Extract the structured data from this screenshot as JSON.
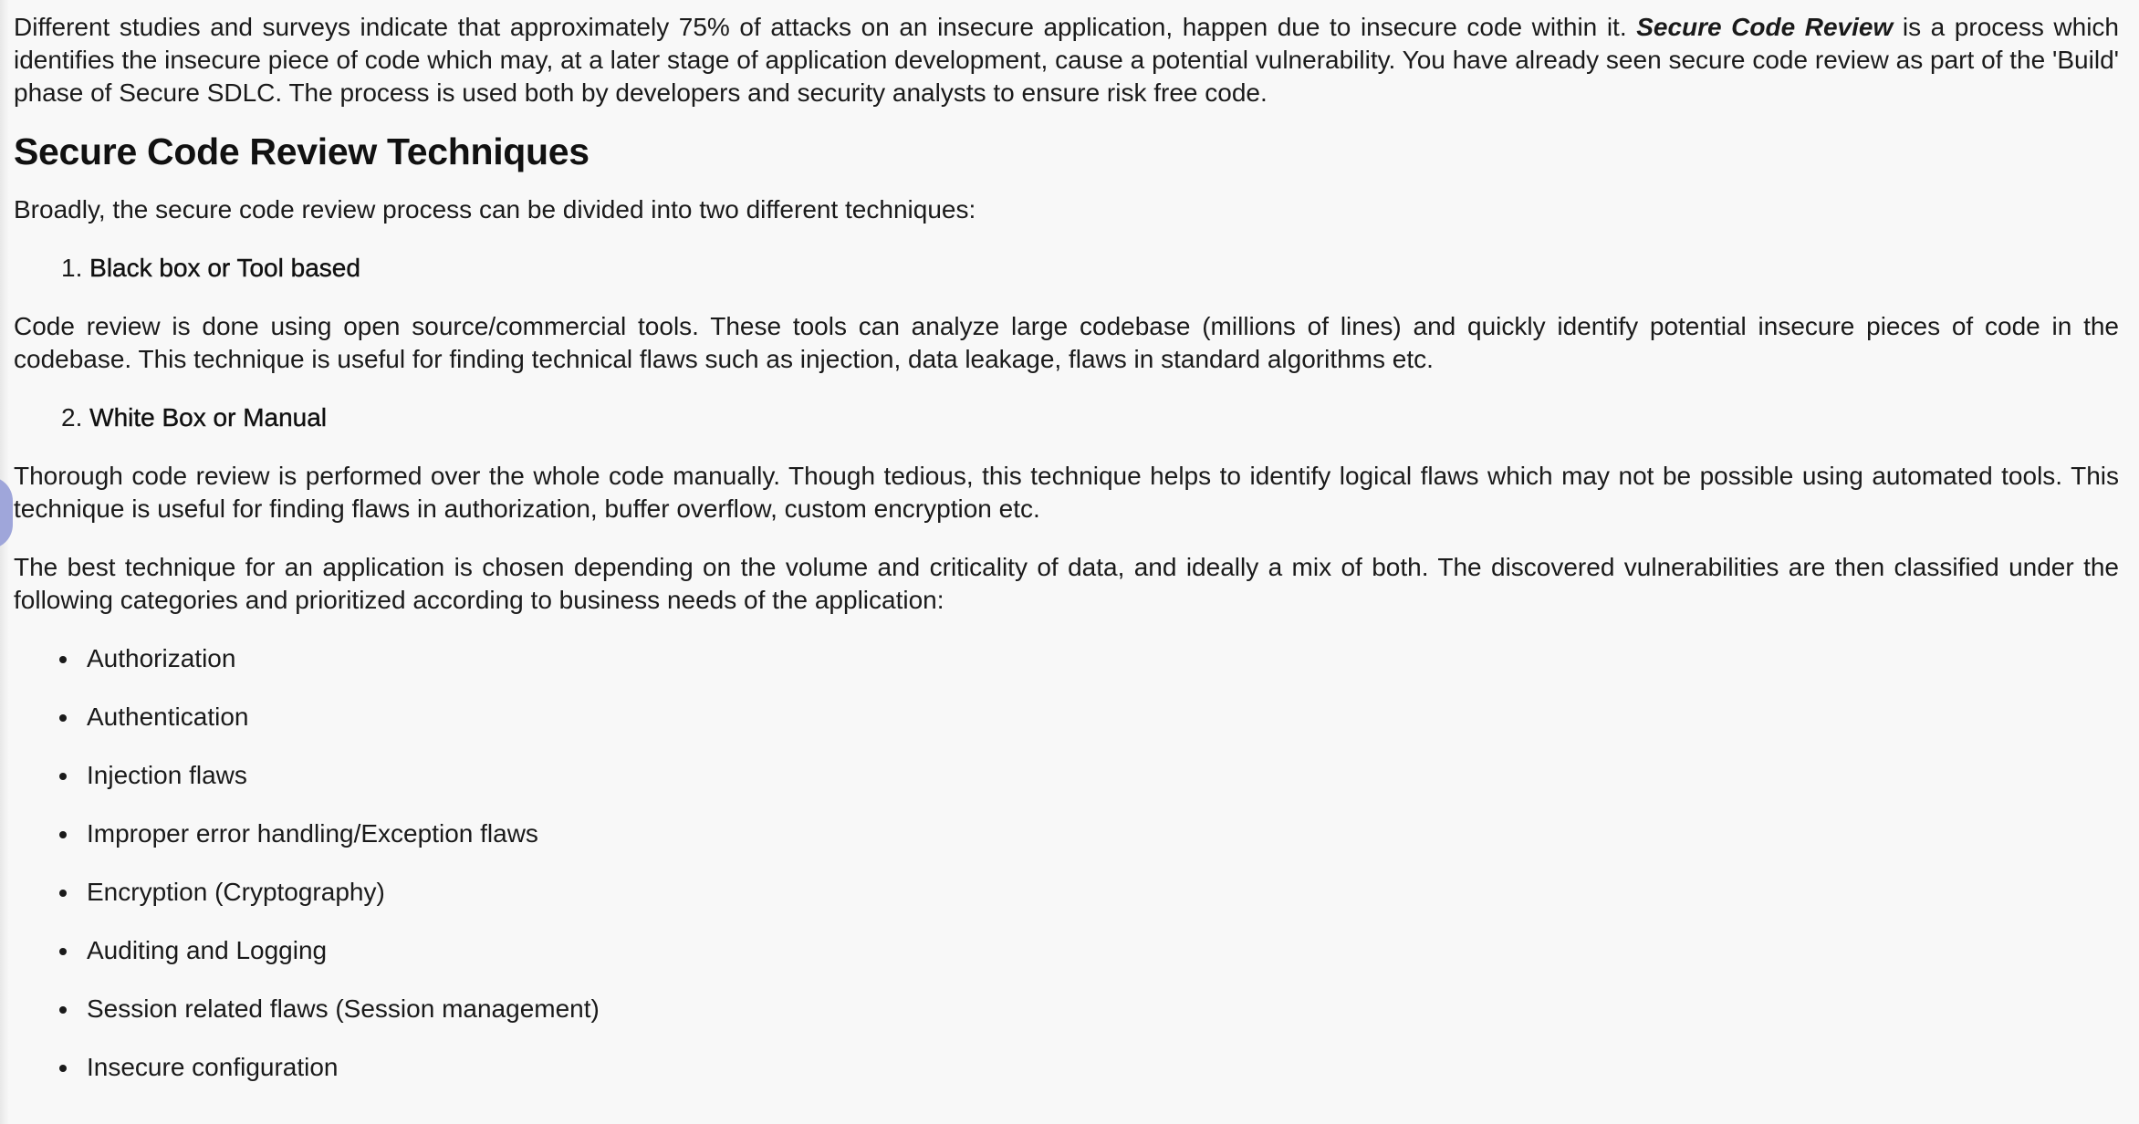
{
  "intro": {
    "text_before": "Different studies and surveys indicate that approximately 75% of attacks on an insecure application, happen due to insecure code within it. ",
    "emphasis": "Secure Code Review",
    "text_after": " is a process which identifies the insecure piece of code which may, at a later stage of application development, cause a potential vulnerability. You have already seen secure code review as part of the 'Build' phase of Secure SDLC. The process is used both by developers and security analysts to ensure risk free code."
  },
  "heading": "Secure Code Review Techniques",
  "lead": "Broadly, the secure code review process can be divided into two different techniques:",
  "techniques": [
    {
      "number": "1.",
      "name": "Black box or Tool based",
      "description": "Code review is done using open source/commercial tools. These tools can analyze large codebase (millions of lines) and quickly identify potential insecure pieces of code in the codebase. This technique is useful for finding technical flaws such as injection, data leakage, flaws in standard algorithms etc."
    },
    {
      "number": "2.",
      "name": "White Box or Manual",
      "description": "Thorough code review is performed over the whole code manually. Though tedious, this technique helps to identify logical flaws which may not be possible using automated tools. This technique is useful for finding flaws in authorization, buffer overflow, custom encryption etc."
    }
  ],
  "best_technique": "The best technique for an application is chosen depending on the volume and criticality of data, and ideally a mix of both. The discovered vulnerabilities are then classified under the following categories and prioritized according  to business needs of the application:",
  "categories": [
    "Authorization",
    "Authentication",
    "Injection flaws",
    "Improper error handling/Exception flaws",
    "Encryption (Cryptography)",
    "Auditing and Logging",
    "Session related flaws (Session management)",
    "Insecure configuration"
  ],
  "colors": {
    "background": "#f8f8f8",
    "text": "#1a1a1a",
    "side_handle": "#9fa6da"
  }
}
